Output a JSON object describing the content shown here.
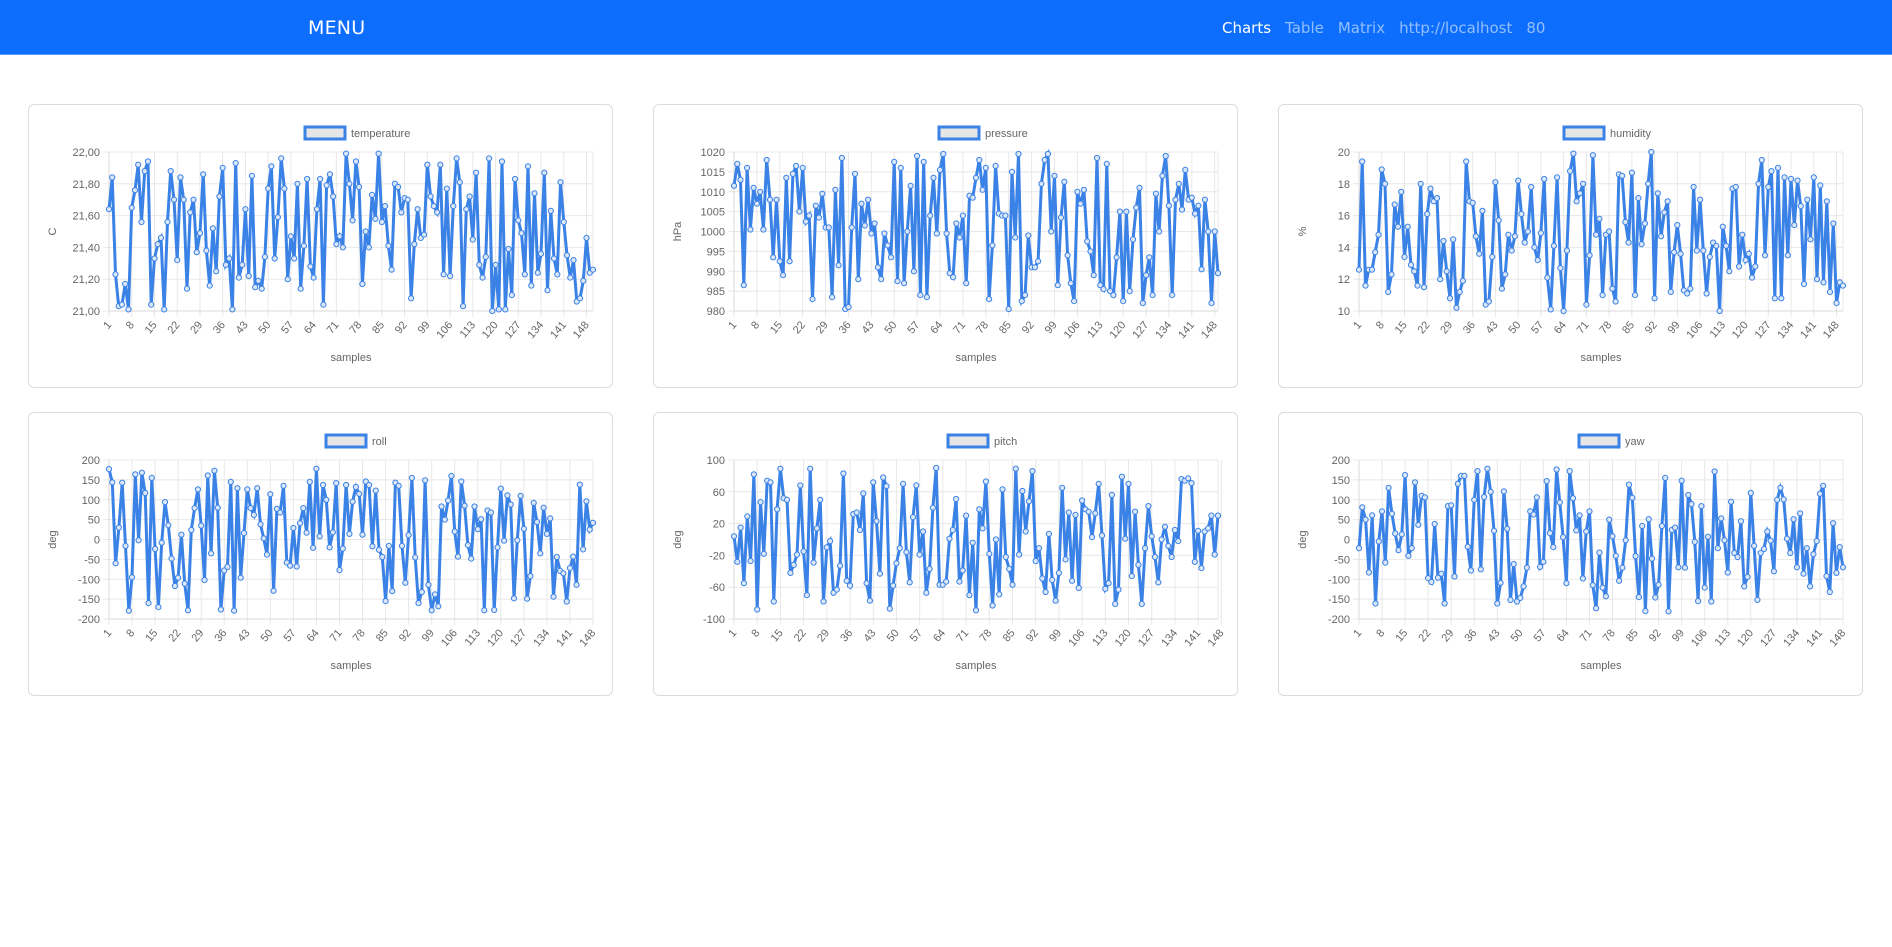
{
  "navbar": {
    "brand": "MENU",
    "links": [
      {
        "label": "Charts",
        "active": true
      },
      {
        "label": "Table",
        "active": false
      },
      {
        "label": "Matrix",
        "active": false
      },
      {
        "label": "http://localhost",
        "active": false
      },
      {
        "label": "80",
        "active": false
      }
    ]
  },
  "colors": {
    "navbar": "#0d6efd",
    "series_line": "#3b82e6",
    "legend_fill": "#e6e6e6",
    "grid": "#e8e8e8"
  },
  "chart_data": [
    {
      "id": "temperature",
      "type": "line",
      "title": "",
      "legend": "temperature",
      "legend_position": "top",
      "xlabel": "samples",
      "ylabel": "C",
      "ylim": [
        21.0,
        22.0
      ],
      "yticks": [
        "22,00",
        "21,80",
        "21,60",
        "21,40",
        "21,20",
        "21,00"
      ],
      "ytick_values": [
        22.0,
        21.8,
        21.6,
        21.4,
        21.2,
        21.0
      ],
      "xticks": [
        "1",
        "8",
        "15",
        "22",
        "29",
        "36",
        "43",
        "50",
        "57",
        "64",
        "71",
        "78",
        "85",
        "92",
        "99",
        "106",
        "113",
        "120",
        "127",
        "134",
        "141",
        "148"
      ],
      "grid": true,
      "values": [
        21.64,
        21.84,
        21.23,
        21.03,
        21.04,
        21.17,
        21.01,
        21.65,
        21.76,
        21.92,
        21.56,
        21.88,
        21.94,
        21.04,
        21.33,
        21.42,
        21.46,
        21.01,
        21.56,
        21.88,
        21.7,
        21.32,
        21.84,
        21.7,
        21.14,
        21.62,
        21.7,
        21.37,
        21.49,
        21.86,
        21.38,
        21.16,
        21.52,
        21.25,
        21.72,
        21.9,
        21.29,
        21.33,
        21.01,
        21.93,
        21.21,
        21.29,
        21.64,
        21.22,
        21.85,
        21.15,
        21.19,
        21.14,
        21.34,
        21.77,
        21.91,
        21.33,
        21.59,
        21.96,
        21.77,
        21.2,
        21.47,
        21.33,
        21.8,
        21.14,
        21.41,
        21.83,
        21.28,
        21.21,
        21.64,
        21.83,
        21.04,
        21.79,
        21.86,
        21.72,
        21.42,
        21.47,
        21.4,
        21.99,
        21.8,
        21.57,
        21.94,
        21.78,
        21.17,
        21.5,
        21.4,
        21.73,
        21.58,
        21.99,
        21.56,
        21.66,
        21.41,
        21.26,
        21.8,
        21.78,
        21.62,
        21.71,
        21.7,
        21.08,
        21.42,
        21.64,
        21.46,
        21.48,
        21.92,
        21.72,
        21.66,
        21.62,
        21.92,
        21.23,
        21.77,
        21.22,
        21.66,
        21.96,
        21.81,
        21.03,
        21.64,
        21.72,
        21.45,
        21.87,
        21.29,
        21.21,
        21.34,
        21.96,
        21.0,
        21.29,
        21.01,
        21.94,
        21.01,
        21.39,
        21.1,
        21.83,
        21.57,
        21.49,
        21.23,
        21.91,
        21.16,
        21.74,
        21.24,
        21.36,
        21.87,
        21.13,
        21.63,
        21.33,
        21.23,
        21.81,
        21.56,
        21.35,
        21.21,
        21.32,
        21.06,
        21.08,
        21.19,
        21.46,
        21.24,
        21.26
      ]
    },
    {
      "id": "pressure",
      "type": "line",
      "title": "",
      "legend": "pressure",
      "legend_position": "top",
      "xlabel": "samples",
      "ylabel": "hPa",
      "ylim": [
        980,
        1020
      ],
      "yticks": [
        "1020",
        "1015",
        "1010",
        "1005",
        "1000",
        "995",
        "990",
        "985",
        "980"
      ],
      "ytick_values": [
        1020,
        1015,
        1010,
        1005,
        1000,
        995,
        990,
        985,
        980
      ],
      "xticks": [
        "1",
        "8",
        "15",
        "22",
        "29",
        "36",
        "43",
        "50",
        "57",
        "64",
        "71",
        "78",
        "85",
        "92",
        "99",
        "106",
        "113",
        "120",
        "127",
        "134",
        "141",
        "148"
      ],
      "grid": true,
      "values": [
        1011.5,
        1017.0,
        1013.0,
        986.5,
        1016.0,
        1000.5,
        1011.0,
        1007.0,
        1010.0,
        1000.5,
        1018.0,
        1008.0,
        993.5,
        1008.0,
        992.5,
        989.0,
        1013.5,
        992.5,
        1014.5,
        1016.5,
        1005.0,
        1016.0,
        1002.5,
        1004.0,
        983.0,
        1006.5,
        1003.5,
        1009.5,
        1001.0,
        1001.0,
        983.5,
        1010.5,
        991.5,
        1018.5,
        980.5,
        981.0,
        1001.0,
        1014.5,
        988.0,
        1007.0,
        1001.5,
        1008.0,
        999.5,
        1002.0,
        991.0,
        988.0,
        999.5,
        996.5,
        993.5,
        1017.5,
        987.5,
        1016.0,
        987.0,
        1000.0,
        1011.5,
        990.0,
        1019.0,
        984.0,
        1017.5,
        983.5,
        1004.0,
        1013.5,
        999.5,
        1015.5,
        1019.5,
        999.5,
        989.5,
        988.5,
        1002.0,
        998.5,
        1004.0,
        987.0,
        1009.0,
        1008.5,
        1013.5,
        1018.0,
        1010.5,
        1016.0,
        983.0,
        996.5,
        1016.5,
        1004.5,
        1004.0,
        1004.0,
        980.5,
        1015.0,
        998.5,
        1019.5,
        982.5,
        984.0,
        999.0,
        991.0,
        991.0,
        992.5,
        1012.0,
        1018.0,
        1019.5,
        1000.0,
        1014.0,
        986.5,
        1003.5,
        1012.5,
        994.0,
        987.0,
        982.5,
        1010.0,
        1007.0,
        1010.5,
        997.5,
        995.0,
        989.0,
        1018.5,
        986.5,
        985.5,
        1017.0,
        985.0,
        984.0,
        993.5,
        1005.0,
        982.5,
        1005.0,
        985.0,
        998.0,
        1006.0,
        1011.0,
        982.0,
        989.0,
        993.5,
        984.0,
        1009.5,
        1000.0,
        1014.0,
        1019.0,
        1006.5,
        984.0,
        1008.0,
        1012.0,
        1005.5,
        1015.5,
        1008.0,
        1008.5,
        1004.5,
        1006.5,
        990.5,
        1008.0,
        1000.0,
        982.0,
        1000.0,
        989.5
      ]
    },
    {
      "id": "humidity",
      "type": "line",
      "title": "",
      "legend": "humidity",
      "legend_position": "top",
      "xlabel": "samples",
      "ylabel": "%",
      "ylim": [
        10,
        20
      ],
      "yticks": [
        "20",
        "18",
        "16",
        "14",
        "12",
        "10"
      ],
      "ytick_values": [
        20,
        18,
        16,
        14,
        12,
        10
      ],
      "xticks": [
        "1",
        "8",
        "15",
        "22",
        "29",
        "36",
        "43",
        "50",
        "57",
        "64",
        "71",
        "78",
        "85",
        "92",
        "99",
        "106",
        "113",
        "120",
        "127",
        "134",
        "141",
        "148"
      ],
      "grid": true,
      "values": [
        12.6,
        19.4,
        11.6,
        12.6,
        12.6,
        13.7,
        14.8,
        18.9,
        18.0,
        11.2,
        12.3,
        16.7,
        15.3,
        17.5,
        13.4,
        15.3,
        12.9,
        12.5,
        11.6,
        18.0,
        11.5,
        16.1,
        17.7,
        16.9,
        17.1,
        12.0,
        14.4,
        12.5,
        10.8,
        14.5,
        10.2,
        11.2,
        11.9,
        19.4,
        16.9,
        16.8,
        14.7,
        13.6,
        16.3,
        10.4,
        10.6,
        13.4,
        18.1,
        15.7,
        11.4,
        12.3,
        14.8,
        13.8,
        14.7,
        18.2,
        16.1,
        14.3,
        15.0,
        17.8,
        14.0,
        13.2,
        14.9,
        18.3,
        12.1,
        10.1,
        14.1,
        18.4,
        12.7,
        10.0,
        13.8,
        18.8,
        19.9,
        16.9,
        17.4,
        18.0,
        10.4,
        13.5,
        19.8,
        14.8,
        15.8,
        11.0,
        14.8,
        15.0,
        11.4,
        10.6,
        18.6,
        18.5,
        15.6,
        14.3,
        18.7,
        11.0,
        17.1,
        14.2,
        15.5,
        18.0,
        20.0,
        10.8,
        17.4,
        14.7,
        16.2,
        16.9,
        11.2,
        13.7,
        15.4,
        13.6,
        11.3,
        11.1,
        11.4,
        17.8,
        13.8,
        17.0,
        13.8,
        11.1,
        13.4,
        14.3,
        14.1,
        10.0,
        15.3,
        14.1,
        12.5,
        17.7,
        17.8,
        12.8,
        14.8,
        13.2,
        13.6,
        12.1,
        12.8,
        18.0,
        19.5,
        13.5,
        17.8,
        18.8,
        10.8,
        19.0,
        10.8,
        18.4,
        13.5,
        18.3,
        15.4,
        18.2,
        16.6,
        11.7,
        17.0,
        14.5,
        18.4,
        12.0,
        17.9,
        11.8,
        16.9,
        11.2,
        15.5,
        10.5,
        11.8,
        11.6
      ]
    },
    {
      "id": "roll",
      "type": "line",
      "title": "",
      "legend": "roll",
      "legend_position": "top",
      "xlabel": "samples",
      "ylabel": "deg",
      "ylim": [
        -200,
        200
      ],
      "yticks": [
        "200",
        "150",
        "100",
        "50",
        "0",
        "-50",
        "-100",
        "-150",
        "-200"
      ],
      "ytick_values": [
        200,
        150,
        100,
        50,
        0,
        -50,
        -100,
        -150,
        -200
      ],
      "xticks": [
        "1",
        "8",
        "15",
        "22",
        "29",
        "36",
        "43",
        "50",
        "57",
        "64",
        "71",
        "78",
        "85",
        "92",
        "99",
        "106",
        "113",
        "120",
        "127",
        "134",
        "141",
        "148"
      ],
      "grid": true,
      "values": [
        177,
        144,
        -60,
        30,
        143,
        -16,
        -179,
        -95,
        164,
        -2,
        168,
        117,
        -160,
        155,
        -24,
        -170,
        -8,
        94,
        36,
        -48,
        -117,
        -96,
        12,
        -111,
        -178,
        24,
        79,
        126,
        35,
        -102,
        161,
        -35,
        173,
        80,
        -176,
        -78,
        -69,
        145,
        -179,
        129,
        -96,
        16,
        126,
        79,
        62,
        129,
        38,
        3,
        -38,
        114,
        -129,
        77,
        68,
        135,
        -58,
        -66,
        29,
        -68,
        41,
        79,
        17,
        145,
        -21,
        178,
        8,
        137,
        100,
        -20,
        18,
        142,
        -77,
        -23,
        137,
        14,
        95,
        132,
        115,
        12,
        146,
        137,
        -17,
        123,
        -26,
        -44,
        -155,
        -16,
        -130,
        143,
        135,
        -16,
        -109,
        11,
        155,
        -45,
        -160,
        -132,
        149,
        -114,
        -178,
        -138,
        -168,
        83,
        50,
        98,
        160,
        20,
        -43,
        146,
        85,
        -14,
        -48,
        83,
        26,
        51,
        -178,
        73,
        68,
        -177,
        -20,
        128,
        -3,
        111,
        88,
        -148,
        -2,
        110,
        27,
        -149,
        -92,
        92,
        44,
        -35,
        80,
        14,
        53,
        -144,
        -44,
        -79,
        -85,
        -156,
        -72,
        -43,
        -114,
        138,
        -25,
        96,
        25,
        42
      ]
    },
    {
      "id": "pitch",
      "type": "line",
      "title": "",
      "legend": "pitch",
      "legend_position": "top",
      "xlabel": "samples",
      "ylabel": "deg",
      "ylim": [
        -100,
        100
      ],
      "yticks": [
        "100",
        "60",
        "20",
        "-20",
        "-60",
        "-100"
      ],
      "ytick_values": [
        100,
        60,
        20,
        -20,
        -60,
        -100
      ],
      "xticks": [
        "1",
        "8",
        "15",
        "22",
        "29",
        "36",
        "43",
        "50",
        "57",
        "64",
        "71",
        "78",
        "85",
        "92",
        "99",
        "106",
        "113",
        "120",
        "127",
        "134",
        "141",
        "148"
      ],
      "grid": true,
      "values": [
        4,
        -28,
        15,
        -55,
        29,
        -27,
        82,
        -88,
        47,
        -18,
        74,
        72,
        -78,
        38,
        89,
        52,
        50,
        -42,
        -32,
        -19,
        68,
        -15,
        -70,
        89,
        -29,
        14,
        50,
        -78,
        -10,
        -2,
        -67,
        -63,
        -33,
        83,
        -52,
        -58,
        32,
        34,
        12,
        58,
        -55,
        -77,
        72,
        23,
        -43,
        78,
        67,
        -87,
        -58,
        -30,
        -11,
        70,
        -16,
        -54,
        28,
        68,
        -19,
        10,
        -67,
        -37,
        40,
        90,
        -57,
        -57,
        -53,
        1,
        12,
        51,
        -53,
        -39,
        30,
        -70,
        -4,
        -89,
        38,
        14,
        73,
        -18,
        -83,
        0,
        -69,
        63,
        -22,
        -37,
        -57,
        89,
        -19,
        61,
        10,
        48,
        86,
        -27,
        -11,
        -49,
        -66,
        7,
        -51,
        -77,
        -42,
        65,
        -25,
        34,
        -52,
        31,
        -61,
        49,
        38,
        35,
        3,
        33,
        70,
        5,
        -62,
        -55,
        56,
        -81,
        -63,
        79,
        1,
        70,
        -46,
        35,
        -32,
        -81,
        -11,
        42,
        4,
        -22,
        -54,
        0,
        16,
        -8,
        -22,
        12,
        -2,
        76,
        74,
        77,
        71,
        -28,
        11,
        -36,
        10,
        14,
        30,
        -19,
        30
      ]
    },
    {
      "id": "yaw",
      "type": "line",
      "title": "",
      "legend": "yaw",
      "legend_position": "top",
      "xlabel": "samples",
      "ylabel": "deg",
      "ylim": [
        -200,
        200
      ],
      "yticks": [
        "200",
        "150",
        "100",
        "50",
        "0",
        "-50",
        "-100",
        "-150",
        "-200"
      ],
      "ytick_values": [
        200,
        150,
        100,
        50,
        0,
        -50,
        -100,
        -150,
        -200
      ],
      "xticks": [
        "1",
        "8",
        "15",
        "22",
        "29",
        "36",
        "43",
        "50",
        "57",
        "64",
        "71",
        "78",
        "85",
        "92",
        "99",
        "106",
        "113",
        "120",
        "127",
        "134",
        "141",
        "148"
      ],
      "grid": true,
      "values": [
        -22,
        81,
        50,
        -83,
        61,
        -161,
        -5,
        71,
        -58,
        130,
        65,
        15,
        -27,
        13,
        162,
        -41,
        -22,
        144,
        37,
        110,
        106,
        -97,
        -107,
        39,
        -96,
        -86,
        -161,
        84,
        86,
        -93,
        140,
        160,
        160,
        -18,
        -78,
        100,
        172,
        -75,
        107,
        178,
        120,
        22,
        -161,
        -109,
        121,
        27,
        -152,
        -62,
        -156,
        -147,
        -118,
        -71,
        71,
        63,
        106,
        -69,
        -56,
        147,
        16,
        -19,
        176,
        93,
        6,
        -110,
        172,
        104,
        23,
        61,
        -98,
        20,
        71,
        -115,
        -173,
        -33,
        -121,
        -143,
        50,
        8,
        -41,
        -104,
        -71,
        -2,
        138,
        105,
        -42,
        -145,
        34,
        -180,
        51,
        -48,
        -146,
        -114,
        34,
        155,
        -181,
        24,
        30,
        -70,
        148,
        -71,
        112,
        89,
        -6,
        -155,
        84,
        -121,
        7,
        -156,
        171,
        -22,
        53,
        -2,
        -83,
        95,
        -34,
        -44,
        46,
        -118,
        -94,
        117,
        -16,
        -152,
        -34,
        -24,
        20,
        -3,
        -80,
        100,
        130,
        101,
        2,
        -34,
        51,
        -70,
        66,
        -86,
        -22,
        -118,
        -37,
        -4,
        115,
        135,
        -92,
        -132,
        41,
        -84,
        -19,
        -70
      ]
    }
  ]
}
